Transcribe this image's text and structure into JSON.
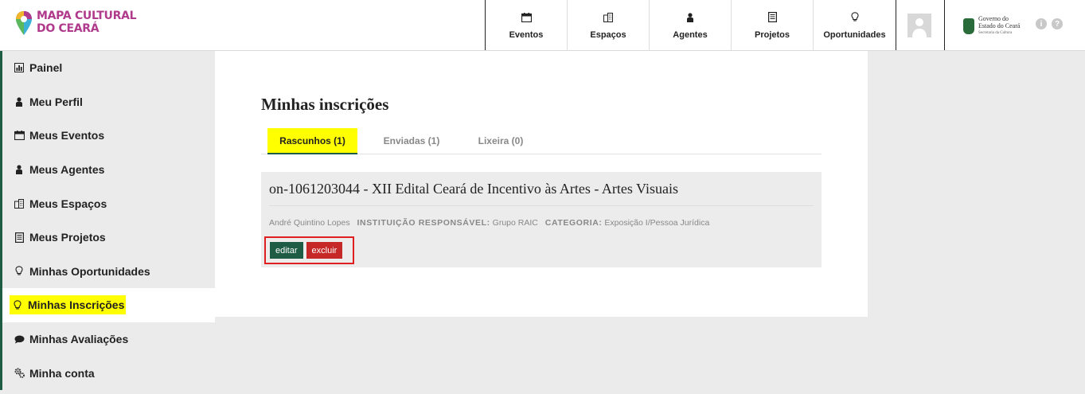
{
  "brand": {
    "line1": "MAPA CULTURAL",
    "line2": "DO CEARÁ"
  },
  "nav": [
    {
      "label": "Eventos",
      "icon": "calendar-icon"
    },
    {
      "label": "Espaços",
      "icon": "building-icon"
    },
    {
      "label": "Agentes",
      "icon": "person-icon"
    },
    {
      "label": "Projetos",
      "icon": "document-icon"
    },
    {
      "label": "Oportunidades",
      "icon": "lightbulb-icon"
    }
  ],
  "gov": {
    "line1": "Governo do",
    "line2": "Estado do Ceará",
    "line3": "Secretaria da Cultura"
  },
  "sidebar": {
    "items": [
      {
        "label": "Painel",
        "icon": "chart-icon"
      },
      {
        "label": "Meu Perfil",
        "icon": "person-icon"
      },
      {
        "label": "Meus Eventos",
        "icon": "calendar-icon"
      },
      {
        "label": "Meus Agentes",
        "icon": "person-icon"
      },
      {
        "label": "Meus Espaços",
        "icon": "building-icon"
      },
      {
        "label": "Meus Projetos",
        "icon": "document-icon"
      },
      {
        "label": "Minhas Oportunidades",
        "icon": "lightbulb-icon"
      },
      {
        "label": "Minhas Inscrições",
        "icon": "lightbulb-icon",
        "active": true
      },
      {
        "label": "Minhas Avaliações",
        "icon": "speech-bubble-icon"
      },
      {
        "label": "Minha conta",
        "icon": "gears-icon"
      }
    ]
  },
  "main": {
    "title": "Minhas inscrições",
    "tabs": [
      {
        "label": "Rascunhos (1)",
        "active": true
      },
      {
        "label": "Enviadas (1)"
      },
      {
        "label": "Lixeira (0)"
      }
    ],
    "card": {
      "title": "on-1061203044 - XII Edital Ceará de Incentivo às Artes - Artes Visuais",
      "agent": "André Quintino Lopes",
      "institution_key": "INSTITUIÇÃO RESPONSÁVEL:",
      "institution_value": "Grupo RAIC",
      "category_key": "CATEGORIA:",
      "category_value": "Exposição I/Pessoa Jurídica",
      "edit_label": "editar",
      "delete_label": "excluir"
    }
  },
  "colors": {
    "accent": "#1e5c46",
    "danger": "#c62828",
    "highlight": "#ffff00",
    "brand": "#b03a8c"
  }
}
